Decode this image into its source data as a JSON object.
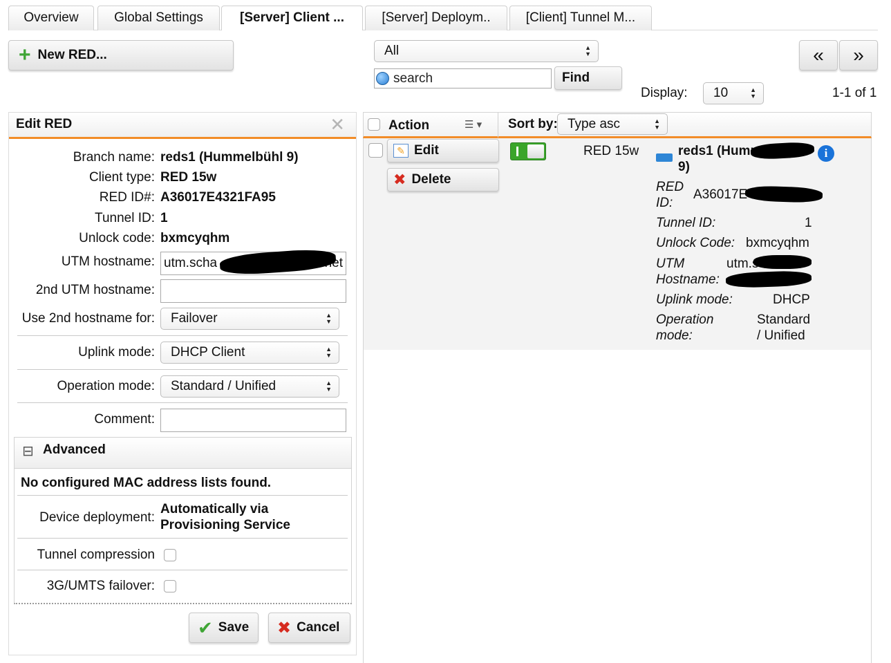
{
  "tabs": [
    {
      "label": "Overview",
      "active": false
    },
    {
      "label": "Global Settings",
      "active": false
    },
    {
      "label": "[Server] Client ...",
      "active": true
    },
    {
      "label": "[Server] Deploym..",
      "active": false
    },
    {
      "label": "[Client] Tunnel M...",
      "active": false
    }
  ],
  "toolbar": {
    "new_button": "New RED...",
    "filter_value": "All",
    "search_placeholder": "search",
    "find_button": "Find",
    "display_label": "Display:",
    "display_value": "10",
    "pagination": "1-1 of 1",
    "prev_glyph": "«",
    "next_glyph": "»"
  },
  "edit_panel": {
    "title": "Edit RED",
    "branch_name_label": "Branch name:",
    "branch_name": "reds1 (Hummelbühl 9)",
    "client_type_label": "Client type:",
    "client_type": "RED 15w",
    "red_id_label": "RED ID#:",
    "red_id": "A36017E4321FA95",
    "tunnel_id_label": "Tunnel ID:",
    "tunnel_id": "1",
    "unlock_code_label": "Unlock code:",
    "unlock_code": "bxmcyqhm",
    "utm_hostname_label": "UTM hostname:",
    "utm_hostname_visible_start": "utm.scha",
    "utm_hostname_visible_end": "net",
    "utm2_label": "2nd UTM hostname:",
    "utm2_value": "",
    "use2_label": "Use 2nd hostname for:",
    "use2_value": "Failover",
    "uplink_label": "Uplink mode:",
    "uplink_value": "DHCP Client",
    "operation_label": "Operation mode:",
    "operation_value": "Standard / Unified",
    "comment_label": "Comment:",
    "comment_value": "",
    "advanced_title": "Advanced",
    "advanced_toggle": "⊟",
    "no_mac": "No configured MAC address lists found.",
    "device_deployment_label": "Device deployment:",
    "device_deployment_line1": "Automatically via",
    "device_deployment_line2": "Provisioning Service",
    "tunnel_compression_label": "Tunnel compression",
    "umts_label": "3G/UMTS failover:",
    "save_button": "Save",
    "cancel_button": "Cancel"
  },
  "list": {
    "action_header": "Action",
    "sort_by_label": "Sort by:",
    "sort_value": "Type asc",
    "row": {
      "edit_button": "Edit",
      "delete_button": "Delete",
      "type": "RED 15w",
      "name_start": "reds1 (Humm",
      "name_end": "9)",
      "red_id_label_1": "RED",
      "red_id_label_2": "ID:",
      "red_id_start": "A36017E",
      "tunnel_id_label": "Tunnel ID:",
      "tunnel_id": "1",
      "unlock_label": "Unlock Code:",
      "unlock_value": "bxmcyqhm",
      "utm_label_1": "UTM",
      "utm_label_2": "Hostname:",
      "utm_start": "utm.s",
      "uplink_label": "Uplink mode:",
      "uplink_value": "DHCP",
      "operation_label_1": "Operation",
      "operation_label_2": "mode:",
      "operation_value_1": "Standard",
      "operation_value_2": "/ Unified"
    }
  },
  "colors": {
    "accent_orange": "#f28c28",
    "toggle_green": "#3aa52a",
    "info_blue": "#1a73d9",
    "delete_red": "#d62b1f",
    "save_green": "#3fa535"
  }
}
